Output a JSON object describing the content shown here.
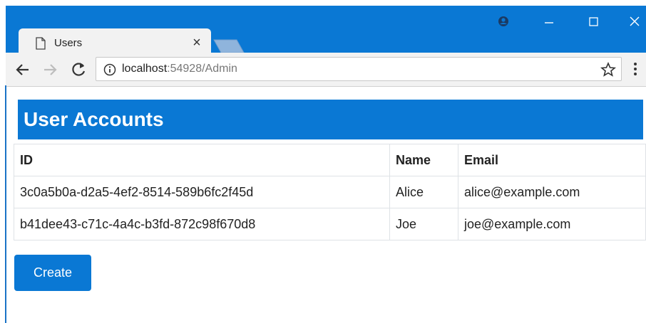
{
  "browser": {
    "tab_title": "Users",
    "tab_close": "×",
    "url_host": "localhost",
    "url_rest": ":54928/Admin",
    "icons": [
      "document-icon",
      "close-icon",
      "profile-icon",
      "minimize-icon",
      "maximize-icon",
      "close-window-icon",
      "back-arrow-icon",
      "forward-arrow-icon",
      "reload-icon",
      "info-icon",
      "star-icon",
      "menu-icon"
    ]
  },
  "page": {
    "heading": "User Accounts",
    "table": {
      "headers": [
        "ID",
        "Name",
        "Email"
      ],
      "rows": [
        [
          "3c0a5b0a-d2a5-4ef2-8514-589b6fc2f45d",
          "Alice",
          "alice@example.com"
        ],
        [
          "b41dee43-c71c-4a4c-b3fd-872c98f670d8",
          "Joe",
          "joe@example.com"
        ]
      ]
    },
    "create_label": "Create"
  },
  "colors": {
    "accent": "#0a78d4",
    "chrome": "#f2f2f2"
  }
}
